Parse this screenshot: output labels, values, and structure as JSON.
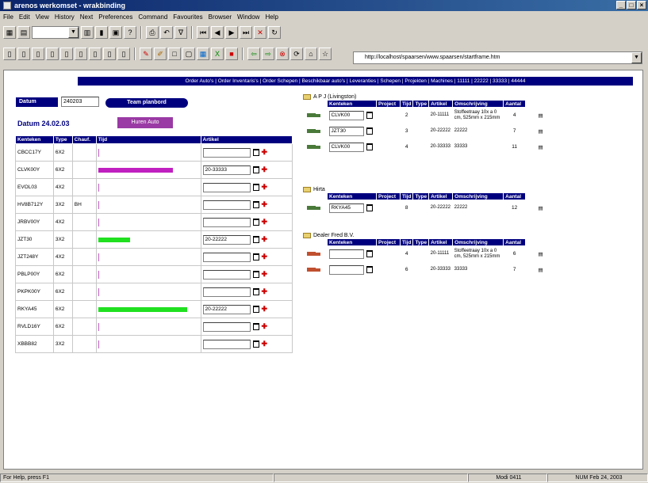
{
  "window": {
    "title": "arenos werkomset - wrakbinding"
  },
  "menu": [
    "File",
    "Edit",
    "View",
    "History",
    "Next",
    "Preferences",
    "Command",
    "Favourites",
    "Browser",
    "Window",
    "Help"
  ],
  "address": {
    "url": "http://localhost/spaarsen/www.spaarsen/startframe.htm"
  },
  "nav": {
    "links": "Order Auto's | Order Inventaris's | Order Schepen | Beschikbaar auto's | Leveranties | Schepen | Projekten | Machines | 11111 | 22222 | 33333 | 44444"
  },
  "left": {
    "datum_label": "Datum",
    "datum_value": "240203",
    "team_button": "Team planbord",
    "datum_heading": "Datum 24.02.03",
    "huren_button": "Huren Auto",
    "headers": [
      "Kenteken",
      "Type",
      "Chauf.",
      "Tijd",
      "Artikel"
    ],
    "rows": [
      {
        "kenteken": "CBCC17Y",
        "type": "6X2",
        "chauf": "",
        "artikel": "",
        "bar_color": "",
        "bar_fraction": 0
      },
      {
        "kenteken": "CLVK00Y",
        "type": "6X2",
        "chauf": "",
        "artikel": "20-33333",
        "bar_color": "#c020c0",
        "bar_fraction": 0.78
      },
      {
        "kenteken": "EVOL03",
        "type": "4X2",
        "chauf": "",
        "artikel": "",
        "bar_color": "",
        "bar_fraction": 0
      },
      {
        "kenteken": "HV8B712Y",
        "type": "3X2",
        "chauf": "BH",
        "artikel": "",
        "bar_color": "",
        "bar_fraction": 0
      },
      {
        "kenteken": "JRBV00Y",
        "type": "4X2",
        "chauf": "",
        "artikel": "",
        "bar_color": "",
        "bar_fraction": 0
      },
      {
        "kenteken": "JZT30",
        "type": "3X2",
        "chauf": "",
        "artikel": "20-22222",
        "bar_color": "#20e020",
        "bar_fraction": 0.33
      },
      {
        "kenteken": "JZT248Y",
        "type": "4X2",
        "chauf": "",
        "artikel": "",
        "bar_color": "",
        "bar_fraction": 0
      },
      {
        "kenteken": "PBLP00Y",
        "type": "6X2",
        "chauf": "",
        "artikel": "",
        "bar_color": "",
        "bar_fraction": 0
      },
      {
        "kenteken": "PKPK00Y",
        "type": "6X2",
        "chauf": "",
        "artikel": "",
        "bar_color": "",
        "bar_fraction": 0
      },
      {
        "kenteken": "RKYA45",
        "type": "6X2",
        "chauf": "",
        "artikel": "20-22222",
        "bar_color": "#20e020",
        "bar_fraction": 0.93
      },
      {
        "kenteken": "RVLD16Y",
        "type": "6X2",
        "chauf": "",
        "artikel": "",
        "bar_color": "",
        "bar_fraction": 0
      },
      {
        "kenteken": "XBBB82",
        "type": "3X2",
        "chauf": "",
        "artikel": "",
        "bar_color": "",
        "bar_fraction": 0
      }
    ]
  },
  "right": {
    "headers": [
      "Kenteken",
      "Project",
      "Tijd",
      "Type",
      "Artikel",
      "Omschrijving",
      "Aantal"
    ],
    "groups": [
      {
        "title": "A P J (Livingston)",
        "red": false,
        "rows": [
          {
            "kenteken": "CLVK00",
            "project": "",
            "tijd": "2",
            "type": "",
            "artikel": "20-11111",
            "omschrijving": "Stoffeetraay 10x a 0 cm, 525mm x 215mm",
            "aantal": "4"
          },
          {
            "kenteken": "JZT30",
            "project": "",
            "tijd": "3",
            "type": "",
            "artikel": "20-22222",
            "omschrijving": "22222",
            "aantal": "7"
          },
          {
            "kenteken": "CLVK00",
            "project": "",
            "tijd": "4",
            "type": "",
            "artikel": "20-33333",
            "omschrijving": "33333",
            "aantal": "11"
          }
        ]
      },
      {
        "title": "Hirta",
        "red": false,
        "rows": [
          {
            "kenteken": "RKYA45",
            "project": "",
            "tijd": "8",
            "type": "",
            "artikel": "20-22222",
            "omschrijving": "22222",
            "aantal": "12"
          }
        ]
      },
      {
        "title": "Dealer Fred B.V.",
        "red": true,
        "rows": [
          {
            "kenteken": "",
            "project": "",
            "tijd": "4",
            "type": "",
            "artikel": "20-11111",
            "omschrijving": "Stoffeetraay 10x a 0 cm, 525mm x 215mm",
            "aantal": "6"
          },
          {
            "kenteken": "",
            "project": "",
            "tijd": "6",
            "type": "",
            "artikel": "20-33333",
            "omschrijving": "33333",
            "aantal": "7"
          }
        ]
      }
    ]
  },
  "status": {
    "left": "For Help, press F1",
    "mode": "Modi 0411",
    "date": "NUM Feb 24, 2003"
  }
}
